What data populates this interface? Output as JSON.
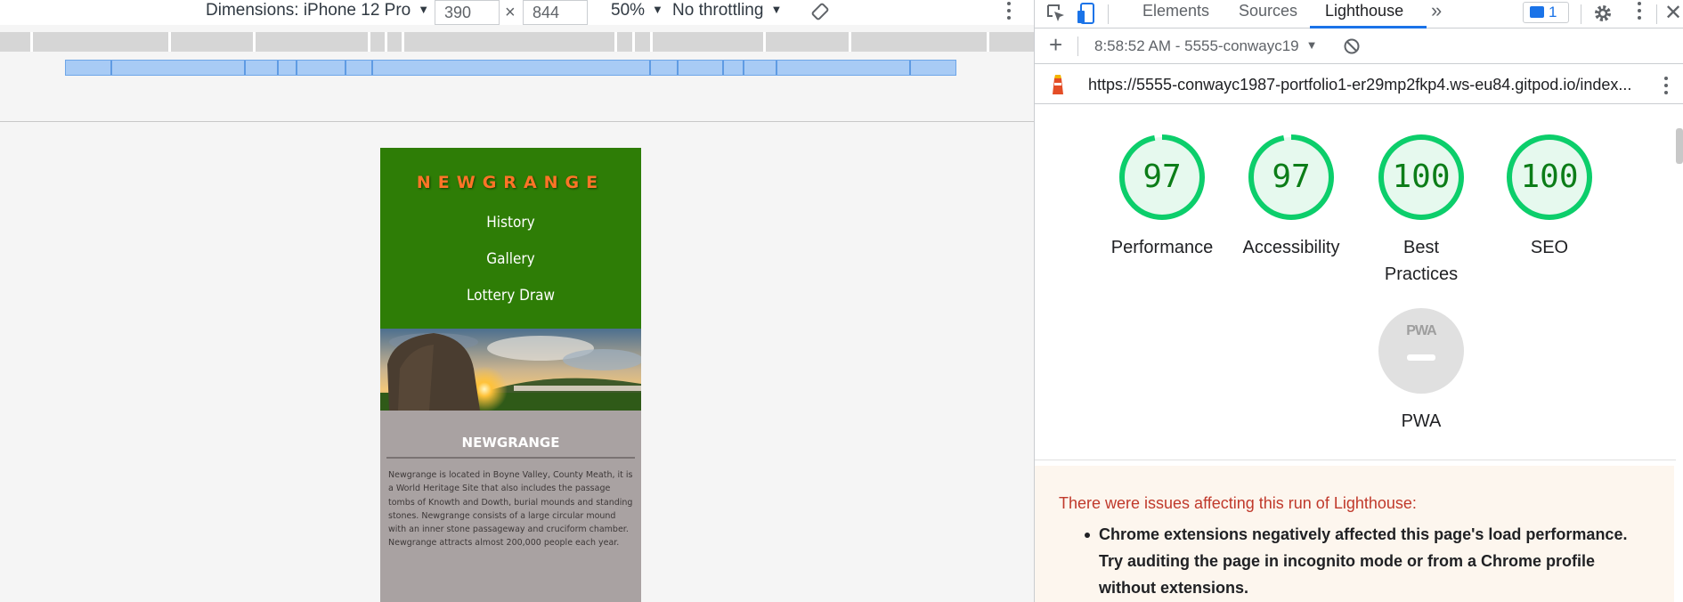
{
  "device_toolbar": {
    "dimensions_label": "Dimensions: iPhone 12 Pro",
    "width": "390",
    "height": "844",
    "zoom": "50%",
    "throttling": "No throttling",
    "times_symbol": "×"
  },
  "site": {
    "brand": "NEWGRANGE",
    "nav": [
      "History",
      "Gallery",
      "Lottery Draw"
    ],
    "section_title": "NEWGRANGE",
    "section_text": "Newgrange is located in Boyne Valley, County Meath, it is a World Heritage Site that also includes the passage tombs of Knowth and Dowth, burial mounds and standing stones. Newgrange consists of a large circular mound with an inner stone passageway and cruciform chamber. Newgrange attracts almost 200,000 people each year.",
    "colors": {
      "header_bg": "#2e7d06",
      "brand": "#ff7427",
      "content_bg": "#a9a2a2"
    }
  },
  "devtools": {
    "tabs": [
      "Elements",
      "Sources",
      "Lighthouse"
    ],
    "active_tab": "Lighthouse",
    "more_tabs": "»",
    "message_count": "1",
    "report_select": "8:58:52 AM - 5555-conwayc19",
    "url": "https://5555-conwayc1987-portfolio1-er29mp2fkp4.ws-eu84.gitpod.io/index...",
    "scores": [
      {
        "value": 97,
        "label": "Performance"
      },
      {
        "value": 97,
        "label": "Accessibility"
      },
      {
        "value": 100,
        "label": "Best Practices"
      },
      {
        "value": 100,
        "label": "SEO"
      }
    ],
    "pwa": {
      "badge": "PWA",
      "label": "PWA"
    },
    "warning_title": "There were issues affecting this run of Lighthouse:",
    "warning_item": "Chrome extensions negatively affected this page's load performance. Try auditing the page in incognito mode or from a Chrome profile without extensions.",
    "colors": {
      "pass": "#0cce6b",
      "score_text": "#0c7d18",
      "accent": "#1a73e8"
    },
    "icons": [
      "inspect-icon",
      "device-toggle-icon",
      "more-tabs-icon",
      "messages-icon",
      "gear-icon",
      "kebab-icon",
      "add-icon",
      "dropdown-icon",
      "clear-icon",
      "lighthouse-icon"
    ]
  }
}
